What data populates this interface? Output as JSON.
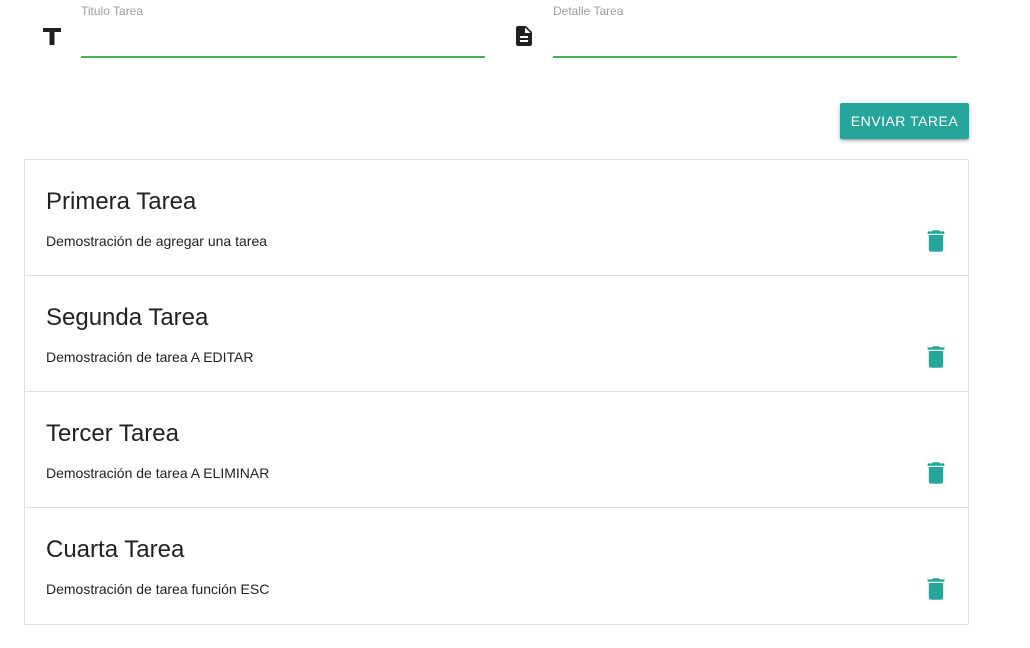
{
  "form": {
    "title_field": {
      "label": "Titulo Tarea",
      "value": "",
      "icon": "title-icon"
    },
    "detail_field": {
      "label": "Detalle Tarea",
      "value": "",
      "icon": "description-icon"
    },
    "submit_label": "ENVIAR TAREA"
  },
  "colors": {
    "accent": "#26a69a",
    "field_underline": "#4caf50",
    "label": "#9e9e9e"
  },
  "tasks": [
    {
      "title": "Primera Tarea",
      "detail": "Demostración de agregar una tarea",
      "action_icon": "delete-icon"
    },
    {
      "title": "Segunda Tarea",
      "detail": "Demostración de tarea A EDITAR",
      "action_icon": "delete-icon"
    },
    {
      "title": "Tercer Tarea",
      "detail": "Demostración de tarea A ELIMINAR",
      "action_icon": "delete-icon"
    },
    {
      "title": "Cuarta Tarea",
      "detail": "Demostración de tarea función ESC",
      "action_icon": "delete-icon"
    }
  ]
}
